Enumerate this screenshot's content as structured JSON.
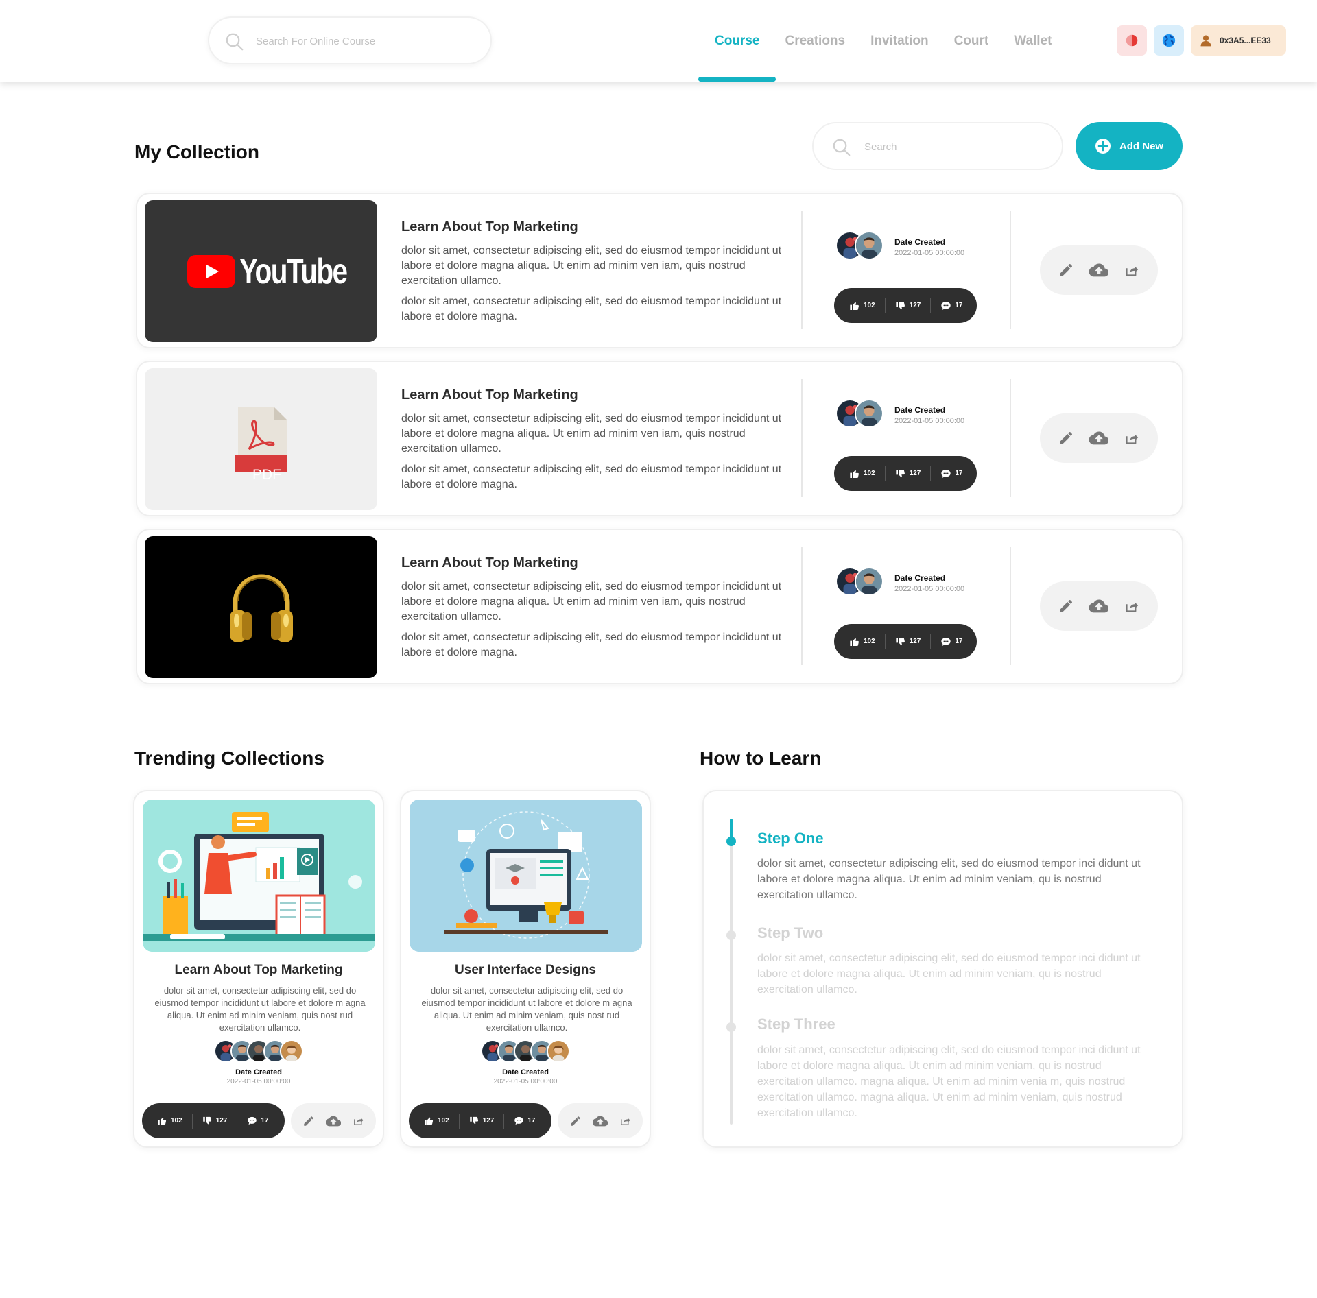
{
  "header": {
    "search_placeholder": "Search For Online Course",
    "nav": [
      {
        "label": "Course",
        "active": true
      },
      {
        "label": "Creations",
        "active": false
      },
      {
        "label": "Invitation",
        "active": false
      },
      {
        "label": "Court",
        "active": false
      },
      {
        "label": "Wallet",
        "active": false
      }
    ],
    "wallet_address": "0x3A5...EE33"
  },
  "my_collection": {
    "title": "My Collection",
    "search_placeholder": "Search",
    "add_label": "Add New",
    "items": [
      {
        "media": "youtube",
        "media_text": "YouTube",
        "title": "Learn About Top Marketing",
        "desc1": "dolor sit amet, consectetur adipiscing elit, sed do eiusmod tempor incididunt ut labore et dolore magna aliqua. Ut enim ad minim ven iam, quis nostrud exercitation ullamco.",
        "desc2": "dolor sit amet, consectetur adipiscing elit, sed do eiusmod tempor incididunt ut labore et dolore magna.",
        "date_label": "Date Created",
        "date": "2022-01-05 00:00:00",
        "likes": "102",
        "dislikes": "127",
        "comments": "17"
      },
      {
        "media": "pdf",
        "media_text": "PDF",
        "title": "Learn About Top Marketing",
        "desc1": "dolor sit amet, consectetur adipiscing elit, sed do eiusmod tempor incididunt ut labore et dolore magna aliqua. Ut enim ad minim ven iam, quis nostrud exercitation ullamco.",
        "desc2": "dolor sit amet, consectetur adipiscing elit, sed do eiusmod tempor incididunt ut labore et dolore magna.",
        "date_label": "Date Created",
        "date": "2022-01-05 00:00:00",
        "likes": "102",
        "dislikes": "127",
        "comments": "17"
      },
      {
        "media": "audio",
        "media_text": "",
        "title": "Learn About Top Marketing",
        "desc1": "dolor sit amet, consectetur adipiscing elit, sed do eiusmod tempor incididunt ut labore et dolore magna aliqua. Ut enim ad minim ven iam, quis nostrud exercitation ullamco.",
        "desc2": "dolor sit amet, consectetur adipiscing elit, sed do eiusmod tempor incididunt ut labore et dolore magna.",
        "date_label": "Date Created",
        "date": "2022-01-05 00:00:00",
        "likes": "102",
        "dislikes": "127",
        "comments": "17"
      }
    ]
  },
  "trending": {
    "title": "Trending Collections",
    "cards": [
      {
        "title": "Learn About Top Marketing",
        "desc": "dolor sit amet, consectetur adipiscing elit, sed do eiusmod tempor incididunt ut labore et dolore m agna aliqua. Ut enim ad minim veniam, quis nost rud exercitation ullamco.",
        "date_label": "Date Created",
        "date": "2022-01-05 00:00:00",
        "likes": "102",
        "dislikes": "127",
        "comments": "17"
      },
      {
        "title": "User Interface Designs",
        "desc": "dolor sit amet, consectetur adipiscing elit, sed do eiusmod tempor incididunt ut labore et dolore m agna aliqua. Ut enim ad minim veniam, quis nost rud exercitation ullamco.",
        "date_label": "Date Created",
        "date": "2022-01-05 00:00:00",
        "likes": "102",
        "dislikes": "127",
        "comments": "17"
      }
    ]
  },
  "how_to_learn": {
    "title": "How to Learn",
    "steps": [
      {
        "title": "Step One",
        "active": true,
        "desc": "dolor sit amet, consectetur adipiscing elit, sed do eiusmod tempor inci didunt ut labore et dolore magna aliqua. Ut enim ad minim veniam, qu is nostrud exercitation ullamco."
      },
      {
        "title": "Step Two",
        "active": false,
        "desc": "dolor sit amet, consectetur adipiscing elit, sed do eiusmod tempor inci didunt ut labore et dolore magna aliqua. Ut enim ad minim veniam, qu is nostrud exercitation ullamco."
      },
      {
        "title": "Step Three",
        "active": false,
        "desc": "dolor sit amet, consectetur adipiscing elit, sed do eiusmod tempor inci didunt ut labore et dolore magna aliqua. Ut enim ad minim veniam, qu is nostrud exercitation ullamco. magna aliqua. Ut enim ad minim venia m, quis nostrud exercitation ullamco. magna aliqua. Ut enim ad minim veniam, quis nostrud exercitation ullamco."
      }
    ]
  },
  "colors": {
    "accent": "#14b3c3",
    "dark_pill": "#2f2f2f",
    "youtube_red": "#ff0000",
    "pdf_red": "#d83b3b"
  }
}
